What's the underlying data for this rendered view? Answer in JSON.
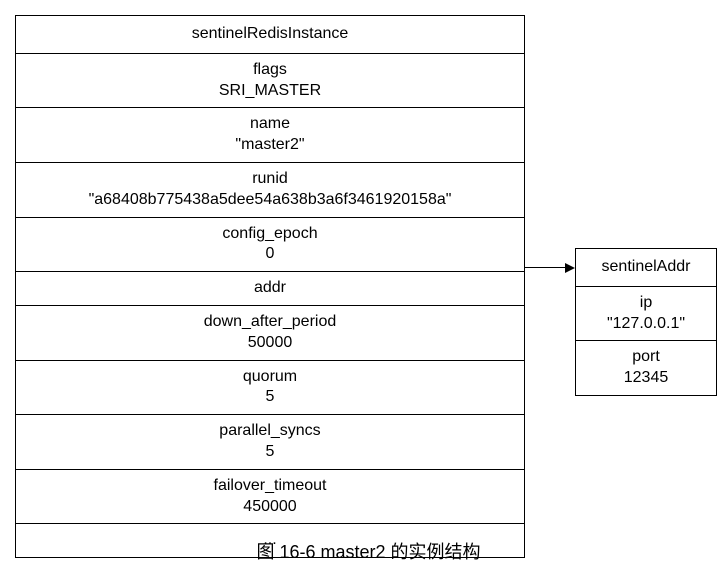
{
  "left": {
    "title": "sentinelRedisInstance",
    "rows": [
      {
        "label": "flags",
        "value": "SRI_MASTER"
      },
      {
        "label": "name",
        "value": "\"master2\""
      },
      {
        "label": "runid",
        "value": "\"a68408b775438a5dee54a638b3a6f3461920158a\""
      },
      {
        "label": "config_epoch",
        "value": "0"
      },
      {
        "label": "addr",
        "value": ""
      },
      {
        "label": "down_after_period",
        "value": "50000"
      },
      {
        "label": "quorum",
        "value": "5"
      },
      {
        "label": "parallel_syncs",
        "value": "5"
      },
      {
        "label": "failover_timeout",
        "value": "450000"
      },
      {
        "label": "...",
        "value": ""
      }
    ]
  },
  "right": {
    "title": "sentinelAddr",
    "rows": [
      {
        "label": "ip",
        "value": "\"127.0.0.1\""
      },
      {
        "label": "port",
        "value": "12345"
      }
    ]
  },
  "caption": "图 16-6    master2 的实例结构"
}
